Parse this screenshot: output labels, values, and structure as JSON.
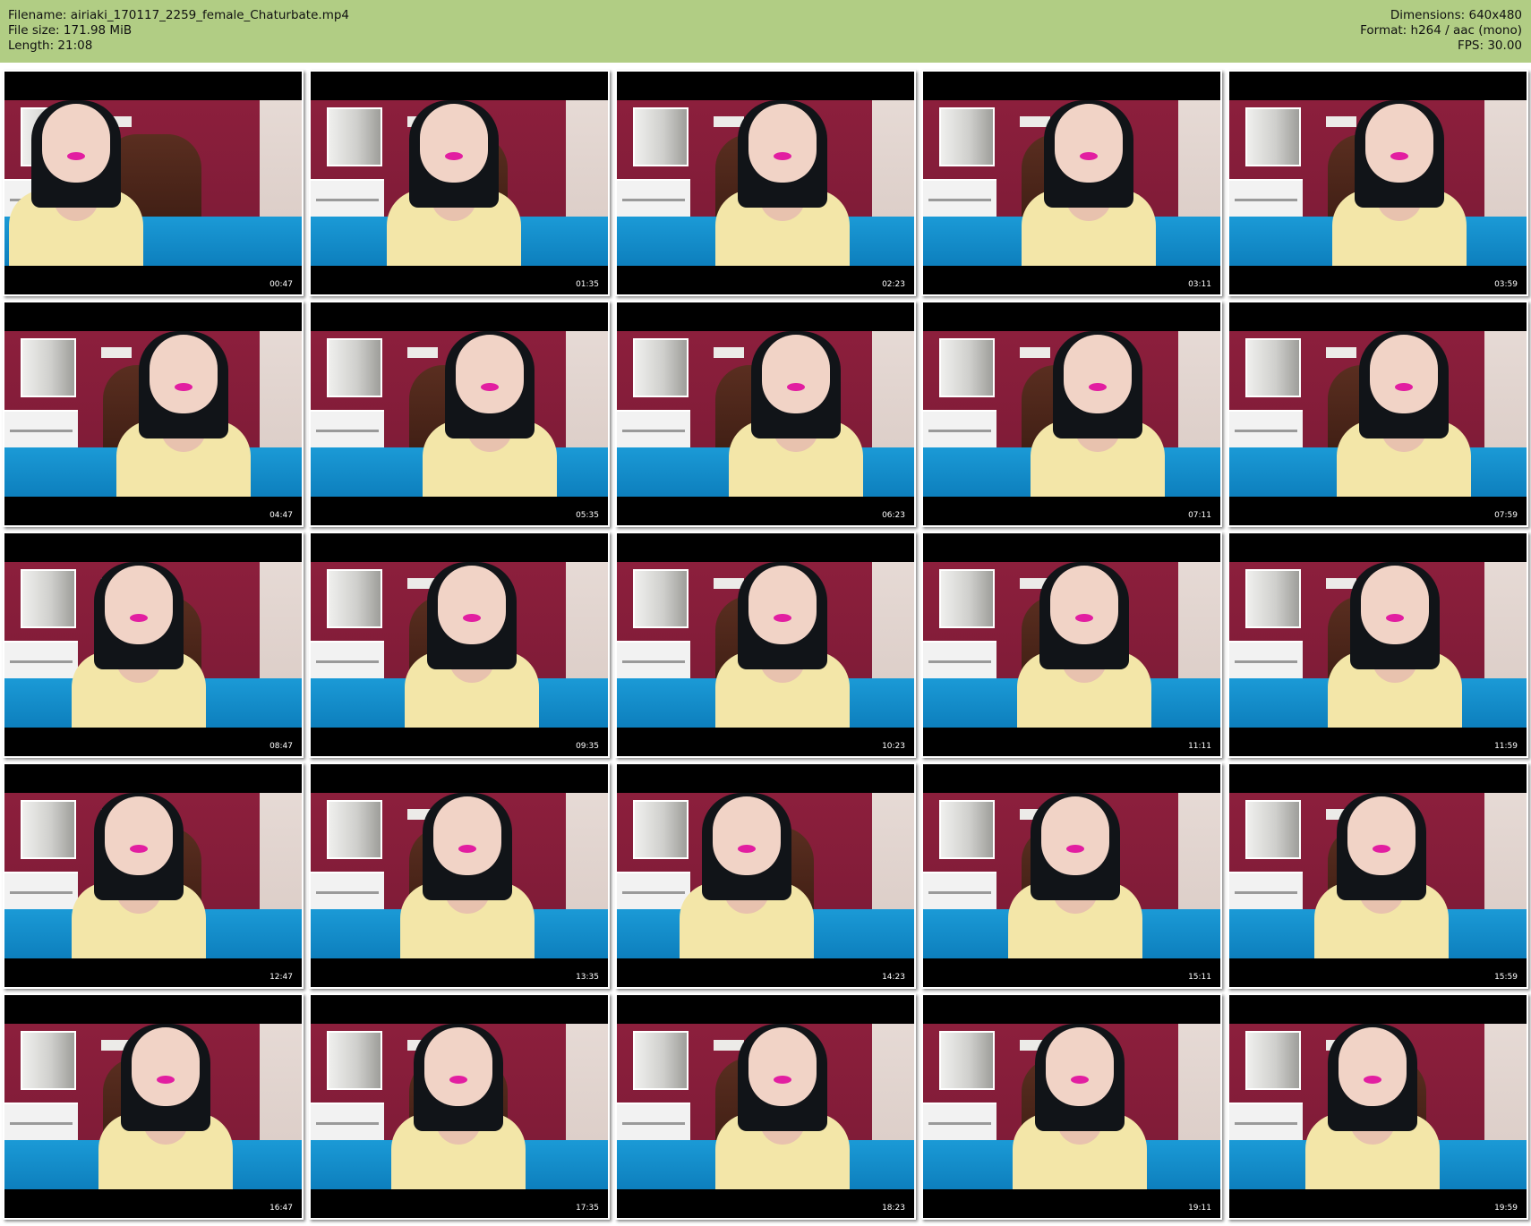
{
  "header": {
    "filename_line": "Filename: airiaki_170117_2259_female_Chaturbate.mp4",
    "filesize_line": "File size: 171.98 MiB",
    "length_line": "Length: 21:08",
    "dimensions_line": "Dimensions: 640x480",
    "format_line": "Format: h264 / aac (mono)",
    "fps_line": "FPS: 30.00",
    "background_color": "#b1cd84"
  },
  "thumbnails": [
    {
      "time": "00:47"
    },
    {
      "time": "01:35"
    },
    {
      "time": "02:23"
    },
    {
      "time": "03:11"
    },
    {
      "time": "03:59"
    },
    {
      "time": "04:47"
    },
    {
      "time": "05:35"
    },
    {
      "time": "06:23"
    },
    {
      "time": "07:11"
    },
    {
      "time": "07:59"
    },
    {
      "time": "08:47"
    },
    {
      "time": "09:35"
    },
    {
      "time": "10:23"
    },
    {
      "time": "11:11"
    },
    {
      "time": "11:59"
    },
    {
      "time": "12:47"
    },
    {
      "time": "13:35"
    },
    {
      "time": "14:23"
    },
    {
      "time": "15:11"
    },
    {
      "time": "15:59"
    },
    {
      "time": "16:47"
    },
    {
      "time": "17:35"
    },
    {
      "time": "18:23"
    },
    {
      "time": "19:11"
    },
    {
      "time": "19:59"
    }
  ]
}
